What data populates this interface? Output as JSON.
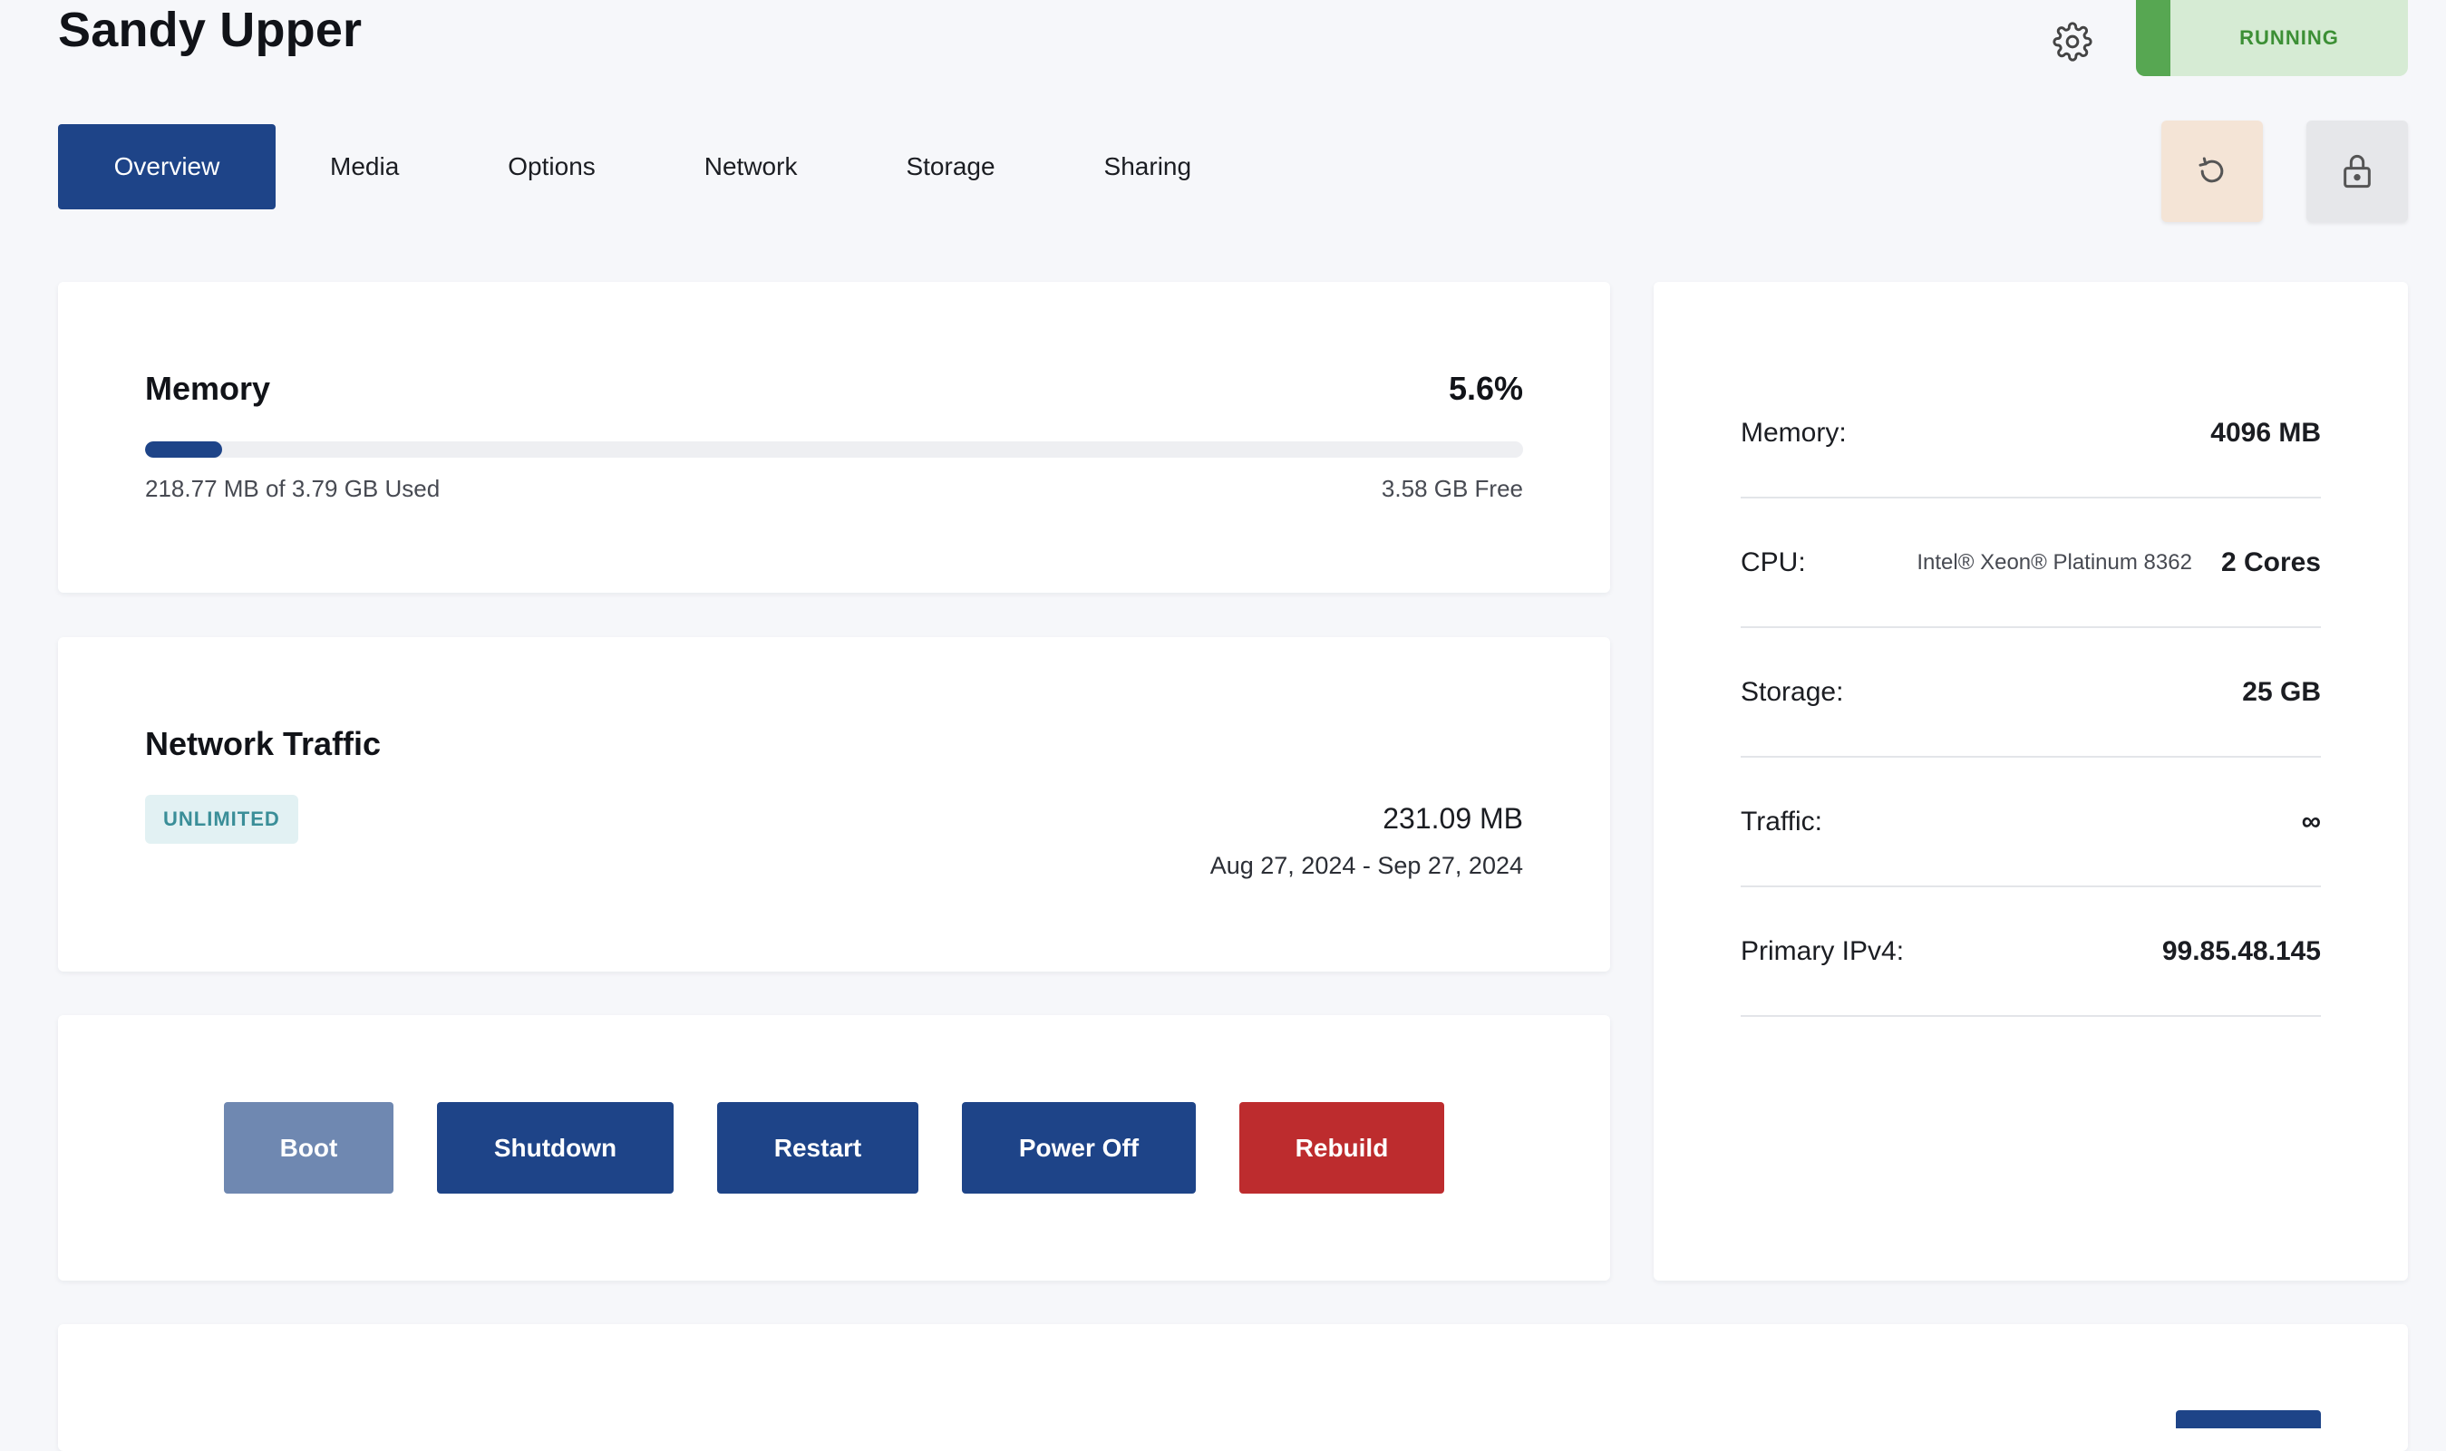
{
  "header": {
    "title": "Sandy Upper",
    "status": "RUNNING"
  },
  "tabs": [
    {
      "label": "Overview",
      "active": true
    },
    {
      "label": "Media"
    },
    {
      "label": "Options"
    },
    {
      "label": "Network"
    },
    {
      "label": "Storage"
    },
    {
      "label": "Sharing"
    }
  ],
  "icons": {
    "settings": "gear-icon",
    "refresh": "refresh-icon",
    "lock": "lock-icon"
  },
  "memory": {
    "title": "Memory",
    "percent_label": "5.6%",
    "percent": 5.6,
    "used_label": "218.77 MB of 3.79 GB Used",
    "free_label": "3.58 GB Free"
  },
  "network_traffic": {
    "title": "Network Traffic",
    "badge": "UNLIMITED",
    "amount": "231.09 MB",
    "date_range": "Aug 27, 2024 - Sep 27, 2024"
  },
  "actions": {
    "boot": "Boot",
    "shutdown": "Shutdown",
    "restart": "Restart",
    "power_off": "Power Off",
    "rebuild": "Rebuild"
  },
  "specs": [
    {
      "label": "Memory:",
      "value": "4096 MB"
    },
    {
      "label": "CPU:",
      "detail": "Intel® Xeon® Platinum 8362",
      "value": "2 Cores"
    },
    {
      "label": "Storage:",
      "value": "25 GB"
    },
    {
      "label": "Traffic:",
      "value": "∞"
    },
    {
      "label": "Primary IPv4:",
      "value": "99.85.48.145"
    }
  ],
  "colors": {
    "primary": "#1e4488",
    "danger": "#bd2c2e",
    "running_bg": "#d6ebd4",
    "running_accent": "#57a752",
    "badge_text": "#3a8e98"
  }
}
